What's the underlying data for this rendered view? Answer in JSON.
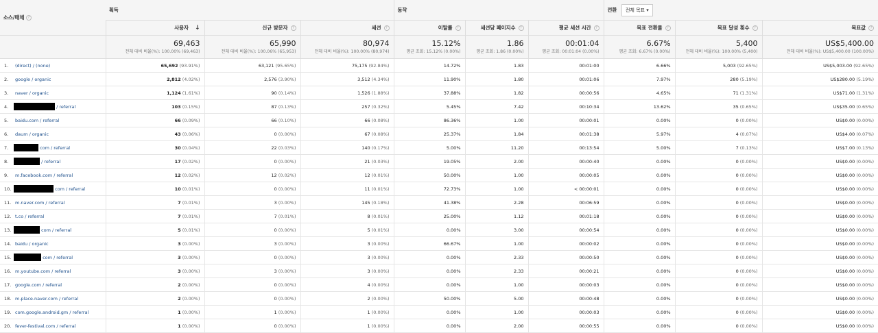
{
  "header": {
    "dimension": "소스/매체",
    "groups": {
      "acquisition": "획득",
      "behavior": "동작",
      "conversion": "전환"
    },
    "goal_select": "전체 목표",
    "columns": [
      "사용자",
      "신규 방문자",
      "세션",
      "이탈률",
      "세션당 페이지수",
      "평균 세션 시간",
      "목표 전환율",
      "목표 달성 횟수",
      "목표값"
    ]
  },
  "totals": [
    {
      "v": "69,463",
      "s": "전체 대비 비율(%): 100.00% (69,463)"
    },
    {
      "v": "65,990",
      "s": "전체 대비 비율(%): 100.06% (65,953)"
    },
    {
      "v": "80,974",
      "s": "전체 대비 비율(%): 100.00% (80,974)"
    },
    {
      "v": "15.12%",
      "s": "평균 조회: 15.12% (0.00%)"
    },
    {
      "v": "1.86",
      "s": "평균 조회: 1.86 (0.00%)"
    },
    {
      "v": "00:01:04",
      "s": "평균 조회: 00:01:04 (0.00%)"
    },
    {
      "v": "6.67%",
      "s": "평균 조회: 6.67% (0.00%)"
    },
    {
      "v": "5,400",
      "s": "전체 대비 비율(%): 100.00% (5,400)"
    },
    {
      "v": "US$5,400.00",
      "s": "전체 대비 비율(%): US$5,400.00 (100.00%)"
    }
  ],
  "rows": [
    {
      "n": "1.",
      "pre": "(direct) / (none)",
      "red": 0,
      "post": "",
      "c": [
        [
          "65,692",
          "(93.91%)"
        ],
        [
          "63,121",
          "(95.65%)"
        ],
        [
          "75,175",
          "(92.84%)"
        ],
        "14.72%",
        "1.83",
        "00:01:00",
        "6.66%",
        [
          "5,003",
          "(92.65%)"
        ],
        [
          "US$5,003.00",
          "(92.65%)"
        ]
      ]
    },
    {
      "n": "2.",
      "pre": "google / organic",
      "red": 0,
      "post": "",
      "c": [
        [
          "2,812",
          "(4.02%)"
        ],
        [
          "2,576",
          "(3.90%)"
        ],
        [
          "3,512",
          "(4.34%)"
        ],
        "11.90%",
        "1.80",
        "00:01:06",
        "7.97%",
        [
          "280",
          "(5.19%)"
        ],
        [
          "US$280.00",
          "(5.19%)"
        ]
      ]
    },
    {
      "n": "3.",
      "pre": "naver / organic",
      "red": 0,
      "post": "",
      "c": [
        [
          "1,124",
          "(1.61%)"
        ],
        [
          "90",
          "(0.14%)"
        ],
        [
          "1,526",
          "(1.88%)"
        ],
        "37.88%",
        "1.82",
        "00:00:56",
        "4.65%",
        [
          "71",
          "(1.31%)"
        ],
        [
          "US$71.00",
          "(1.31%)"
        ]
      ]
    },
    {
      "n": "4.",
      "pre": "",
      "red": 60,
      "post": "/ referral",
      "c": [
        [
          "103",
          "(0.15%)"
        ],
        [
          "87",
          "(0.13%)"
        ],
        [
          "257",
          "(0.32%)"
        ],
        "5.45%",
        "7.42",
        "00:10:34",
        "13.62%",
        [
          "35",
          "(0.65%)"
        ],
        [
          "US$35.00",
          "(0.65%)"
        ]
      ]
    },
    {
      "n": "5.",
      "pre": "baidu.com / referral",
      "red": 0,
      "post": "",
      "c": [
        [
          "66",
          "(0.09%)"
        ],
        [
          "66",
          "(0.10%)"
        ],
        [
          "66",
          "(0.08%)"
        ],
        "86.36%",
        "1.00",
        "00:00:01",
        "0.00%",
        [
          "0",
          "(0.00%)"
        ],
        [
          "US$0.00",
          "(0.00%)"
        ]
      ]
    },
    {
      "n": "6.",
      "pre": "daum / organic",
      "red": 0,
      "post": "",
      "c": [
        [
          "43",
          "(0.06%)"
        ],
        [
          "0",
          "(0.00%)"
        ],
        [
          "67",
          "(0.08%)"
        ],
        "25.37%",
        "1.84",
        "00:01:38",
        "5.97%",
        [
          "4",
          "(0.07%)"
        ],
        [
          "US$4.00",
          "(0.07%)"
        ]
      ]
    },
    {
      "n": "7.",
      "pre": "",
      "red": 36,
      "post": "com / referral",
      "c": [
        [
          "30",
          "(0.04%)"
        ],
        [
          "22",
          "(0.03%)"
        ],
        [
          "140",
          "(0.17%)"
        ],
        "5.00%",
        "11.20",
        "00:13:54",
        "5.00%",
        [
          "7",
          "(0.13%)"
        ],
        [
          "US$7.00",
          "(0.13%)"
        ]
      ]
    },
    {
      "n": "8.",
      "pre": "",
      "red": 38,
      "post": "/ referral",
      "c": [
        [
          "17",
          "(0.02%)"
        ],
        [
          "0",
          "(0.00%)"
        ],
        [
          "21",
          "(0.03%)"
        ],
        "19.05%",
        "2.00",
        "00:00:40",
        "0.00%",
        [
          "0",
          "(0.00%)"
        ],
        [
          "US$0.00",
          "(0.00%)"
        ]
      ]
    },
    {
      "n": "9.",
      "pre": "m.facebook.com / referral",
      "red": 0,
      "post": "",
      "c": [
        [
          "12",
          "(0.02%)"
        ],
        [
          "12",
          "(0.02%)"
        ],
        [
          "12",
          "(0.01%)"
        ],
        "50.00%",
        "1.00",
        "00:00:05",
        "0.00%",
        [
          "0",
          "(0.00%)"
        ],
        [
          "US$0.00",
          "(0.00%)"
        ]
      ]
    },
    {
      "n": "10.",
      "pre": "",
      "red": 58,
      "post": "com / referral",
      "c": [
        [
          "10",
          "(0.01%)"
        ],
        [
          "0",
          "(0.00%)"
        ],
        [
          "11",
          "(0.01%)"
        ],
        "72.73%",
        "1.00",
        "< 00:00:01",
        "0.00%",
        [
          "0",
          "(0.00%)"
        ],
        [
          "US$0.00",
          "(0.00%)"
        ]
      ]
    },
    {
      "n": "11.",
      "pre": "m.naver.com / referral",
      "red": 0,
      "post": "",
      "c": [
        [
          "7",
          "(0.01%)"
        ],
        [
          "3",
          "(0.00%)"
        ],
        [
          "145",
          "(0.18%)"
        ],
        "41.38%",
        "2.28",
        "00:06:59",
        "0.00%",
        [
          "0",
          "(0.00%)"
        ],
        [
          "US$0.00",
          "(0.00%)"
        ]
      ]
    },
    {
      "n": "12.",
      "pre": "t.co / referral",
      "red": 0,
      "post": "",
      "c": [
        [
          "7",
          "(0.01%)"
        ],
        [
          "7",
          "(0.01%)"
        ],
        [
          "8",
          "(0.01%)"
        ],
        "25.00%",
        "1.12",
        "00:01:18",
        "0.00%",
        [
          "0",
          "(0.00%)"
        ],
        [
          "US$0.00",
          "(0.00%)"
        ]
      ]
    },
    {
      "n": "13.",
      "pre": "",
      "red": 38,
      "post": "com / referral",
      "c": [
        [
          "5",
          "(0.01%)"
        ],
        [
          "0",
          "(0.00%)"
        ],
        [
          "5",
          "(0.01%)"
        ],
        "0.00%",
        "3.00",
        "00:00:54",
        "0.00%",
        [
          "0",
          "(0.00%)"
        ],
        [
          "US$0.00",
          "(0.00%)"
        ]
      ]
    },
    {
      "n": "14.",
      "pre": "baidu / organic",
      "red": 0,
      "post": "",
      "c": [
        [
          "3",
          "(0.00%)"
        ],
        [
          "3",
          "(0.00%)"
        ],
        [
          "3",
          "(0.00%)"
        ],
        "66.67%",
        "1.00",
        "00:00:02",
        "0.00%",
        [
          "0",
          "(0.00%)"
        ],
        [
          "US$0.00",
          "(0.00%)"
        ]
      ]
    },
    {
      "n": "15.",
      "pre": "",
      "red": 40,
      "post": "com / referral",
      "c": [
        [
          "3",
          "(0.00%)"
        ],
        [
          "0",
          "(0.00%)"
        ],
        [
          "3",
          "(0.00%)"
        ],
        "0.00%",
        "2.33",
        "00:00:50",
        "0.00%",
        [
          "0",
          "(0.00%)"
        ],
        [
          "US$0.00",
          "(0.00%)"
        ]
      ]
    },
    {
      "n": "16.",
      "pre": "m.youtube.com / referral",
      "red": 0,
      "post": "",
      "c": [
        [
          "3",
          "(0.00%)"
        ],
        [
          "3",
          "(0.00%)"
        ],
        [
          "3",
          "(0.00%)"
        ],
        "0.00%",
        "2.33",
        "00:00:21",
        "0.00%",
        [
          "0",
          "(0.00%)"
        ],
        [
          "US$0.00",
          "(0.00%)"
        ]
      ]
    },
    {
      "n": "17.",
      "pre": "google.com / referral",
      "red": 0,
      "post": "",
      "c": [
        [
          "2",
          "(0.00%)"
        ],
        [
          "0",
          "(0.00%)"
        ],
        [
          "4",
          "(0.00%)"
        ],
        "0.00%",
        "1.00",
        "00:00:03",
        "0.00%",
        [
          "0",
          "(0.00%)"
        ],
        [
          "US$0.00",
          "(0.00%)"
        ]
      ]
    },
    {
      "n": "18.",
      "pre": "m.place.naver.com / referral",
      "red": 0,
      "post": "",
      "c": [
        [
          "2",
          "(0.00%)"
        ],
        [
          "0",
          "(0.00%)"
        ],
        [
          "2",
          "(0.00%)"
        ],
        "50.00%",
        "5.00",
        "00:00:48",
        "0.00%",
        [
          "0",
          "(0.00%)"
        ],
        [
          "US$0.00",
          "(0.00%)"
        ]
      ]
    },
    {
      "n": "19.",
      "pre": "com.google.android.gm / referral",
      "red": 0,
      "post": "",
      "c": [
        [
          "1",
          "(0.00%)"
        ],
        [
          "1",
          "(0.00%)"
        ],
        [
          "1",
          "(0.00%)"
        ],
        "0.00%",
        "1.00",
        "00:00:03",
        "0.00%",
        [
          "0",
          "(0.00%)"
        ],
        [
          "US$0.00",
          "(0.00%)"
        ]
      ]
    },
    {
      "n": "20.",
      "pre": "fever-festival.com / referral",
      "red": 0,
      "post": "",
      "c": [
        [
          "1",
          "(0.00%)"
        ],
        [
          "0",
          "(0.00%)"
        ],
        [
          "1",
          "(0.00%)"
        ],
        "0.00%",
        "2.00",
        "00:00:55",
        "0.00%",
        [
          "0",
          "(0.00%)"
        ],
        [
          "US$0.00",
          "(0.00%)"
        ]
      ]
    }
  ]
}
